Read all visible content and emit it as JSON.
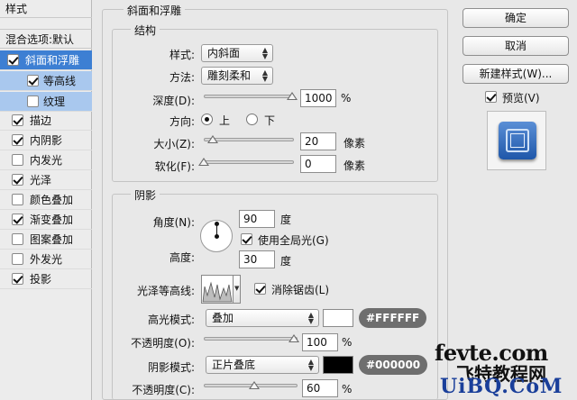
{
  "left_panel": {
    "header": "样式",
    "blend": "混合选项:默认",
    "items": [
      {
        "label": "斜面和浮雕",
        "checked": true
      },
      {
        "label": "等高线",
        "checked": true
      },
      {
        "label": "纹理",
        "checked": false
      },
      {
        "label": "描边",
        "checked": true
      },
      {
        "label": "内阴影",
        "checked": true
      },
      {
        "label": "内发光",
        "checked": false
      },
      {
        "label": "光泽",
        "checked": true
      },
      {
        "label": "颜色叠加",
        "checked": false
      },
      {
        "label": "渐变叠加",
        "checked": true
      },
      {
        "label": "图案叠加",
        "checked": false
      },
      {
        "label": "外发光",
        "checked": false
      },
      {
        "label": "投影",
        "checked": true
      }
    ]
  },
  "bevel": {
    "section_title": "斜面和浮雕",
    "structure_title": "结构",
    "style_label": "样式:",
    "style_value": "内斜面",
    "technique_label": "方法:",
    "technique_value": "雕刻柔和",
    "depth_label": "深度(D):",
    "depth_value": "1000",
    "depth_unit": "%",
    "depth_level": 1.0,
    "direction_label": "方向:",
    "direction_up": "上",
    "direction_down": "下",
    "size_label": "大小(Z):",
    "size_value": "20",
    "size_unit": "像素",
    "soften_label": "软化(F):",
    "soften_value": "0",
    "soften_unit": "像素"
  },
  "shading": {
    "title": "阴影",
    "angle_label": "角度(N):",
    "angle_value": "90",
    "angle_unit": "度",
    "global_light_label": "使用全局光(G)",
    "altitude_label": "高度:",
    "altitude_value": "30",
    "altitude_unit": "度",
    "gloss_label": "光泽等高线:",
    "antialias_label": "消除锯齿(L)",
    "highlight_mode_label": "高光模式:",
    "highlight_mode_value": "叠加",
    "highlight_color": "#FFFFFF",
    "highlight_color_label": "#FFFFFF",
    "highlight_opacity_label": "不透明度(O):",
    "highlight_opacity_value": "100",
    "highlight_opacity_unit": "%",
    "shadow_mode_label": "阴影模式:",
    "shadow_mode_value": "正片叠底",
    "shadow_color": "#000000",
    "shadow_color_label": "#000000",
    "shadow_opacity_label": "不透明度(C):",
    "shadow_opacity_value": "60",
    "shadow_opacity_unit": "%"
  },
  "buttons": {
    "ok": "确定",
    "cancel": "取消",
    "new_style": "新建样式(W)...",
    "preview_label": "预览(V)"
  },
  "watermark": {
    "line1": "fevte.com",
    "line2": "飞特教程网",
    "line3": "UiBQ.CoM"
  }
}
